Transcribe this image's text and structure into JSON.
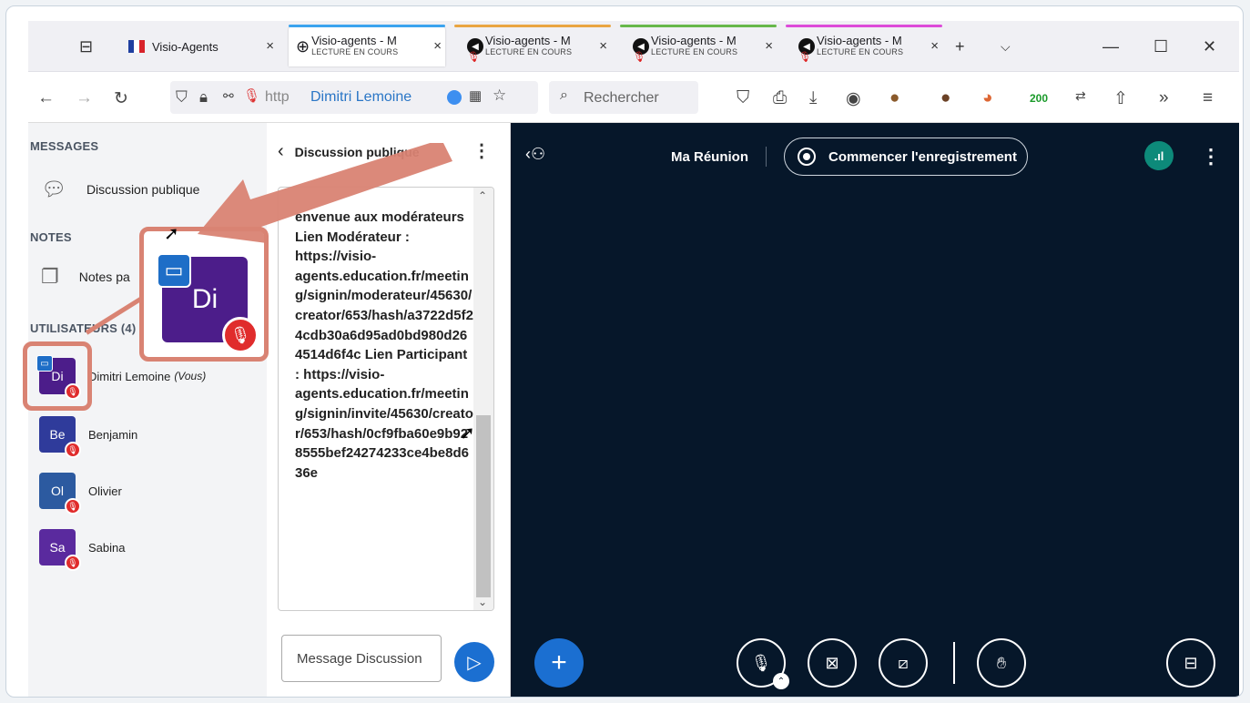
{
  "browser": {
    "tabs": [
      {
        "title": "Visio-Agents",
        "sub": ""
      },
      {
        "title": "Visio-agents - M",
        "sub": "LECTURE EN COURS"
      },
      {
        "title": "Visio-agents - M",
        "sub": "LECTURE EN COURS"
      },
      {
        "title": "Visio-agents - M",
        "sub": "LECTURE EN COURS"
      },
      {
        "title": "Visio-agents - M",
        "sub": "LECTURE EN COURS"
      }
    ],
    "tab_colors": [
      "#3ba3ee",
      "#e9a542",
      "#67b84a",
      "#dd4bd9"
    ],
    "url_prefix": "http",
    "url_name": "Dimitri Lemoine",
    "search_placeholder": "Rechercher",
    "badge_200": "200"
  },
  "sidebar": {
    "messages_title": "MESSAGES",
    "public_chat": "Discussion publique",
    "notes_title": "NOTES",
    "shared_notes": "Notes pa",
    "users_title": "UTILISATEURS (4)",
    "users": [
      {
        "initials": "Di",
        "name": "Dimitri Lemoine",
        "you": "(Vous)",
        "color": "#4c1d8a"
      },
      {
        "initials": "Be",
        "name": "Benjamin",
        "you": "",
        "color": "#2f3b9b"
      },
      {
        "initials": "Ol",
        "name": "Olivier",
        "you": "",
        "color": "#2c5aa0"
      },
      {
        "initials": "Sa",
        "name": "Sabina",
        "you": "",
        "color": "#5a2a9e"
      }
    ]
  },
  "chat": {
    "header": "Discussion publique",
    "message": "envenue aux modérateurs Lien Modérateur : https://visio-agents.education.fr/meeting/signin/moderateur/45630/creator/653/hash/a3722d5f24cdb30a6d95ad0bd980d264514d6f4c Lien Participant : https://visio-agents.education.fr/meeting/signin/invite/45630/creator/653/hash/0cf9fba60e9b928555bef24274233ce4be8d636e",
    "input_placeholder": "Message Discussion"
  },
  "meeting": {
    "title": "Ma Réunion",
    "record_label": "Commencer l'enregistrement"
  },
  "zoom_avatar": {
    "initials": "Di"
  }
}
